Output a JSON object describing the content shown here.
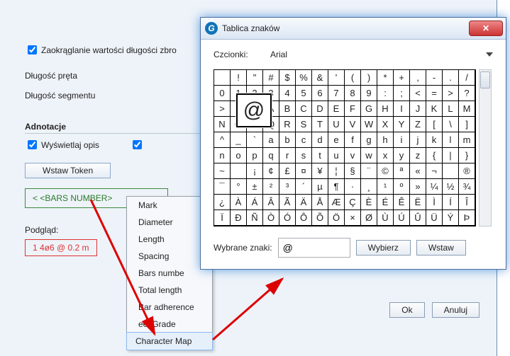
{
  "back": {
    "checkbox_round": "Zaokrąglanie wartości długości zbro",
    "bar_length_label": "Długość pręta",
    "segment_length_label": "Długość segmentu",
    "annotations_title": "Adnotacje",
    "checkbox_show_desc": "Wyświetlaj opis",
    "insert_token_btn": "Wstaw Token",
    "green_preview": "< <BARS NUMBER>",
    "podglad_label": "Podgląd:",
    "podglad_value": "1 4ø6 @ 0.2 m"
  },
  "ctx": {
    "items": [
      "Mark",
      "Diameter",
      "Length",
      "Spacing",
      "Bars numbe",
      "Total length",
      "Bar adherence",
      "eel Grade",
      "Character Map"
    ]
  },
  "dialog": {
    "title": "Tablica znaków",
    "font_label": "Czcionki:",
    "font_name": "Arial",
    "selected_label": "Wybrane znaki:",
    "selected_value": "@",
    "choose_btn": "Wybierz",
    "insert_btn": "Wstaw",
    "ok_btn": "Ok",
    "cancel_btn": "Anuluj",
    "mag_char": "@",
    "grid": [
      [
        " ",
        "!",
        "\"",
        "#",
        "$",
        "%",
        "&",
        "'",
        "(",
        ")",
        "*",
        "+",
        ",",
        "-",
        ".",
        "/"
      ],
      [
        "0",
        "1",
        "2",
        "3",
        "4",
        "5",
        "6",
        "7",
        "8",
        "9",
        ":",
        ";",
        "<",
        "=",
        ">",
        "?"
      ],
      [
        ">",
        "?",
        "@",
        "A",
        "B",
        "C",
        "D",
        "E",
        "F",
        "G",
        "H",
        "I",
        "J",
        "K",
        "L",
        "M"
      ],
      [
        "N",
        "O",
        "P",
        "Q",
        "R",
        "S",
        "T",
        "U",
        "V",
        "W",
        "X",
        "Y",
        "Z",
        "[",
        "\\",
        "]"
      ],
      [
        "^",
        "_",
        "`",
        "a",
        "b",
        "c",
        "d",
        "e",
        "f",
        "g",
        "h",
        "i",
        "j",
        "k",
        "l",
        "m"
      ],
      [
        "n",
        "o",
        "p",
        "q",
        "r",
        "s",
        "t",
        "u",
        "v",
        "w",
        "x",
        "y",
        "z",
        "{",
        "|",
        "}"
      ],
      [
        "~",
        " ",
        "¡",
        "¢",
        "£",
        "¤",
        "¥",
        "¦",
        "§",
        "¨",
        "©",
        "ª",
        "«",
        "¬",
        " ",
        "®"
      ],
      [
        "¯",
        "°",
        "±",
        "²",
        "³",
        "´",
        "µ",
        "¶",
        "·",
        "¸",
        "¹",
        "º",
        "»",
        "¼",
        "½",
        "¾"
      ],
      [
        "¿",
        "À",
        "Á",
        "Â",
        "Ã",
        "Ä",
        "Å",
        "Æ",
        "Ç",
        "È",
        "É",
        "Ê",
        "Ë",
        "Ì",
        "Í",
        "Î"
      ],
      [
        "Ï",
        "Ð",
        "Ñ",
        "Ò",
        "Ó",
        "Ô",
        "Õ",
        "Ö",
        "×",
        "Ø",
        "Ù",
        "Ú",
        "Û",
        "Ü",
        "Ý",
        "Þ"
      ]
    ]
  }
}
